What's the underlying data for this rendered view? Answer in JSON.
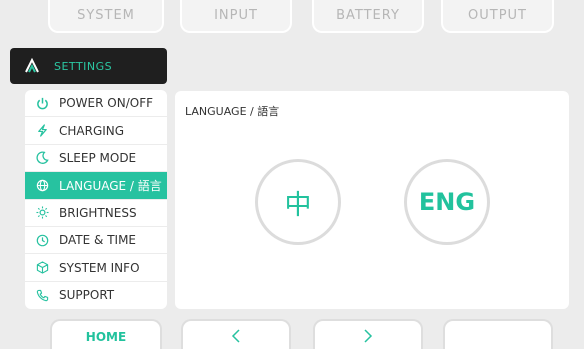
{
  "top_tabs": [
    "SYSTEM",
    "INPUT",
    "BATTERY",
    "OUTPUT"
  ],
  "settings": {
    "title": "SETTINGS"
  },
  "menu": [
    {
      "label": "POWER ON/OFF",
      "icon": "power-icon"
    },
    {
      "label": "CHARGING",
      "icon": "bolt-icon"
    },
    {
      "label": "SLEEP MODE",
      "icon": "moon-icon"
    },
    {
      "label": "LANGUAGE / 語言",
      "icon": "globe-icon",
      "active": true
    },
    {
      "label": "BRIGHTNESS",
      "icon": "sun-icon"
    },
    {
      "label": "DATE & TIME",
      "icon": "clock-icon"
    },
    {
      "label": "SYSTEM INFO",
      "icon": "cube-icon"
    },
    {
      "label": "SUPPORT",
      "icon": "phone-icon"
    }
  ],
  "panel": {
    "title": "LANGUAGE / 語言",
    "zh_label": "中",
    "en_label": "ENG"
  },
  "bottom_nav": {
    "home_label": "HOME",
    "prev_symbol": "<",
    "next_symbol": ">"
  },
  "colors": {
    "accent": "#27c2a0",
    "header_bg": "#1f1f1f",
    "background": "#ececec"
  }
}
